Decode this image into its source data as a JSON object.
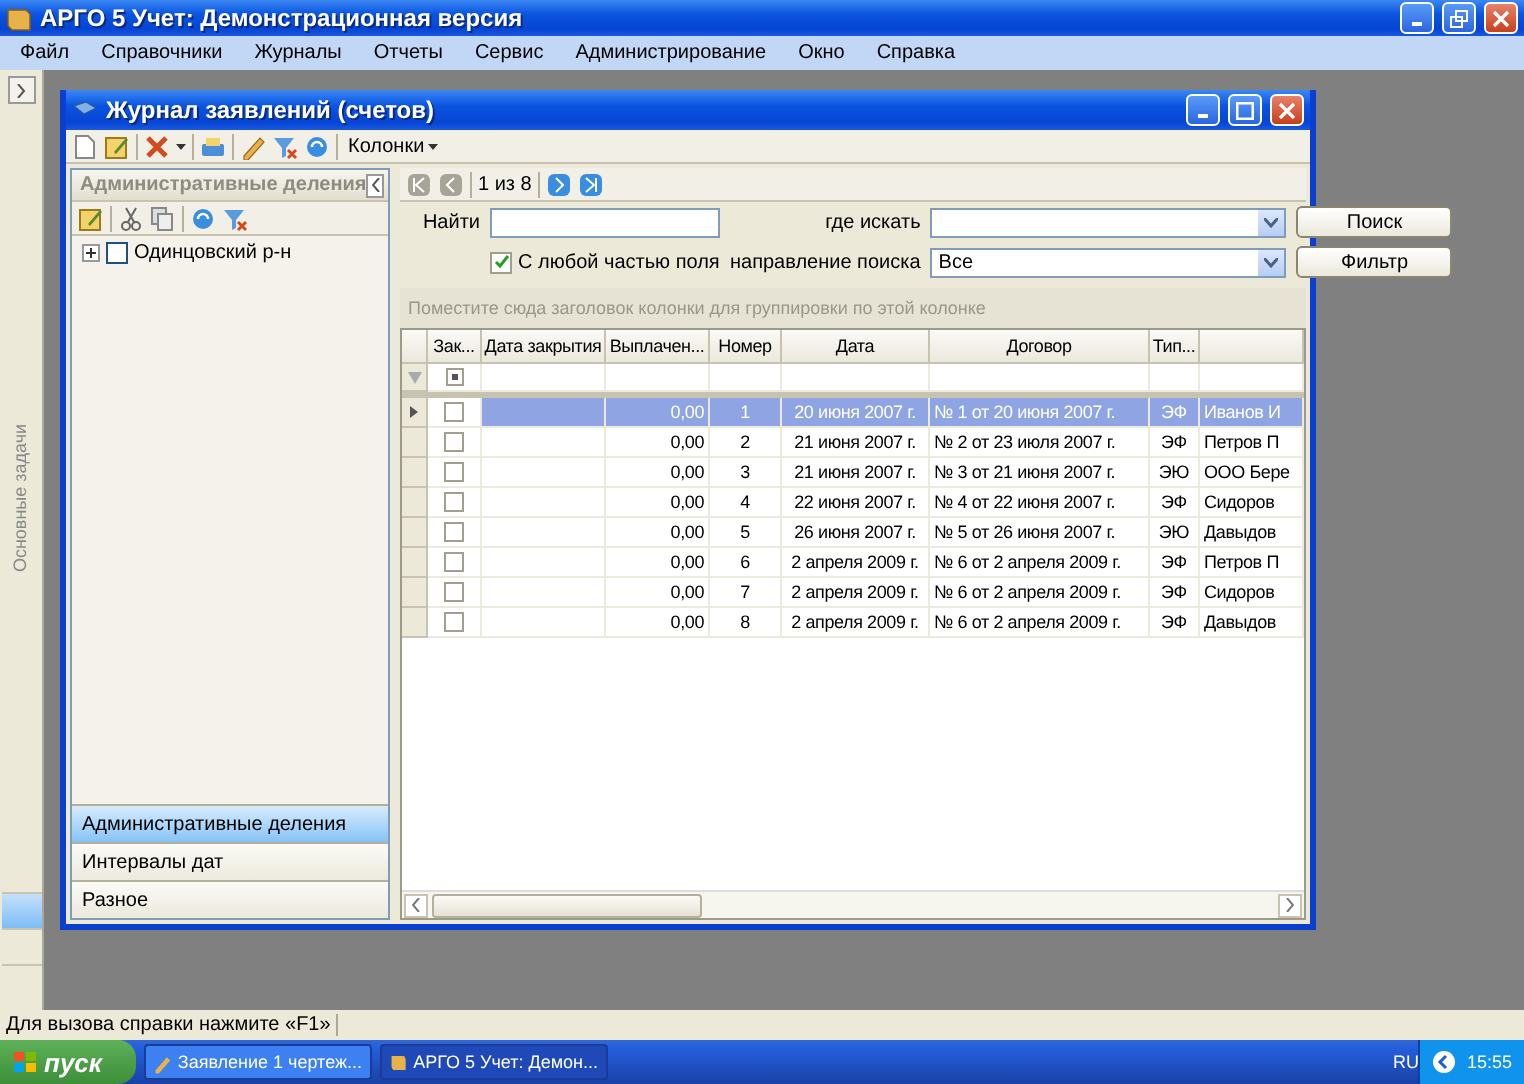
{
  "app_window": {
    "title": "АРГО 5 Учет: Демонстрационная версия"
  },
  "menu": [
    "Файл",
    "Справочники",
    "Журналы",
    "Отчеты",
    "Сервис",
    "Администрирование",
    "Окно",
    "Справка"
  ],
  "task_strip": {
    "title": "Основные задачи",
    "tabs": [
      {
        "selected": true
      },
      {
        "selected": false
      },
      {
        "selected": false
      }
    ]
  },
  "child_window": {
    "title": "Журнал заявлений (счетов)",
    "columns_menu": "Колонки"
  },
  "left_panel": {
    "title": "Административные деления",
    "tree": [
      {
        "label": "Одинцовский р-н",
        "checked": false,
        "expanded": false
      }
    ],
    "nav": [
      {
        "label": "Административные деления",
        "selected": true
      },
      {
        "label": "Интервалы дат",
        "selected": false
      },
      {
        "label": "Разное",
        "selected": false
      }
    ]
  },
  "pager": {
    "position": "1 из 8"
  },
  "search": {
    "find_label": "Найти",
    "where_label": "где искать",
    "any_part": {
      "label": "С любой частью поля",
      "checked": true
    },
    "direction_label": "направление поиска",
    "direction_value": "Все",
    "buttons": [
      "Поиск",
      "Фильтр"
    ]
  },
  "grid": {
    "group_hint": "Поместите сюда заголовок колонки для группировки по этой колонке",
    "filter_checkbox": {
      "indeterminate": true
    },
    "columns": [
      "Зак...",
      "Дата закрытия",
      "Выплачен...",
      "Номер",
      "Дата",
      "Договор",
      "Тип..."
    ],
    "rows": [
      {
        "selected": true,
        "closed": false,
        "paid": "0,00",
        "number": "1",
        "date": "20 июня 2007 г.",
        "contract": "№ 1 от 20 июня 2007 г.",
        "type": "ЭФ",
        "column_9": "Иванов И"
      },
      {
        "selected": false,
        "closed": false,
        "paid": "0,00",
        "number": "2",
        "date": "21 июня 2007 г.",
        "contract": "№ 2 от 23 июля 2007 г.",
        "type": "ЭФ",
        "column_9": "Петров П"
      },
      {
        "selected": false,
        "closed": false,
        "paid": "0,00",
        "number": "3",
        "date": "21 июня 2007 г.",
        "contract": "№ 3 от 21 июня 2007 г.",
        "type": "ЭЮ",
        "column_9": "ООО Бере"
      },
      {
        "selected": false,
        "closed": false,
        "paid": "0,00",
        "number": "4",
        "date": "22 июня 2007 г.",
        "contract": "№ 4 от 22 июня 2007 г.",
        "type": "ЭФ",
        "column_9": "Сидоров"
      },
      {
        "selected": false,
        "closed": false,
        "paid": "0,00",
        "number": "5",
        "date": "26 июня 2007 г.",
        "contract": "№ 5 от 26 июня 2007 г.",
        "type": "ЭЮ",
        "column_9": "Давыдов"
      },
      {
        "selected": false,
        "closed": false,
        "paid": "0,00",
        "number": "6",
        "date": "2 апреля 2009 г.",
        "contract": "№ 6 от 2 апреля 2009 г.",
        "type": "ЭФ",
        "column_9": "Петров П"
      },
      {
        "selected": false,
        "closed": false,
        "paid": "0,00",
        "number": "7",
        "date": "2 апреля 2009 г.",
        "contract": "№ 6 от 2 апреля 2009 г.",
        "type": "ЭФ",
        "column_9": "Сидоров"
      },
      {
        "selected": false,
        "closed": false,
        "paid": "0,00",
        "number": "8",
        "date": "2 апреля 2009 г.",
        "contract": "№ 6 от 2 апреля 2009 г.",
        "type": "ЭФ",
        "column_9": "Давыдов"
      }
    ]
  },
  "status_bar": "Для вызова справки нажмите «F1»",
  "taskbar": {
    "start": "пуск",
    "tasks": [
      {
        "label": "Заявление 1 чертеж...",
        "selected": false
      },
      {
        "label": "АРГО 5 Учет: Демон...",
        "selected": true
      }
    ],
    "language": "RU",
    "time": "15:55"
  }
}
